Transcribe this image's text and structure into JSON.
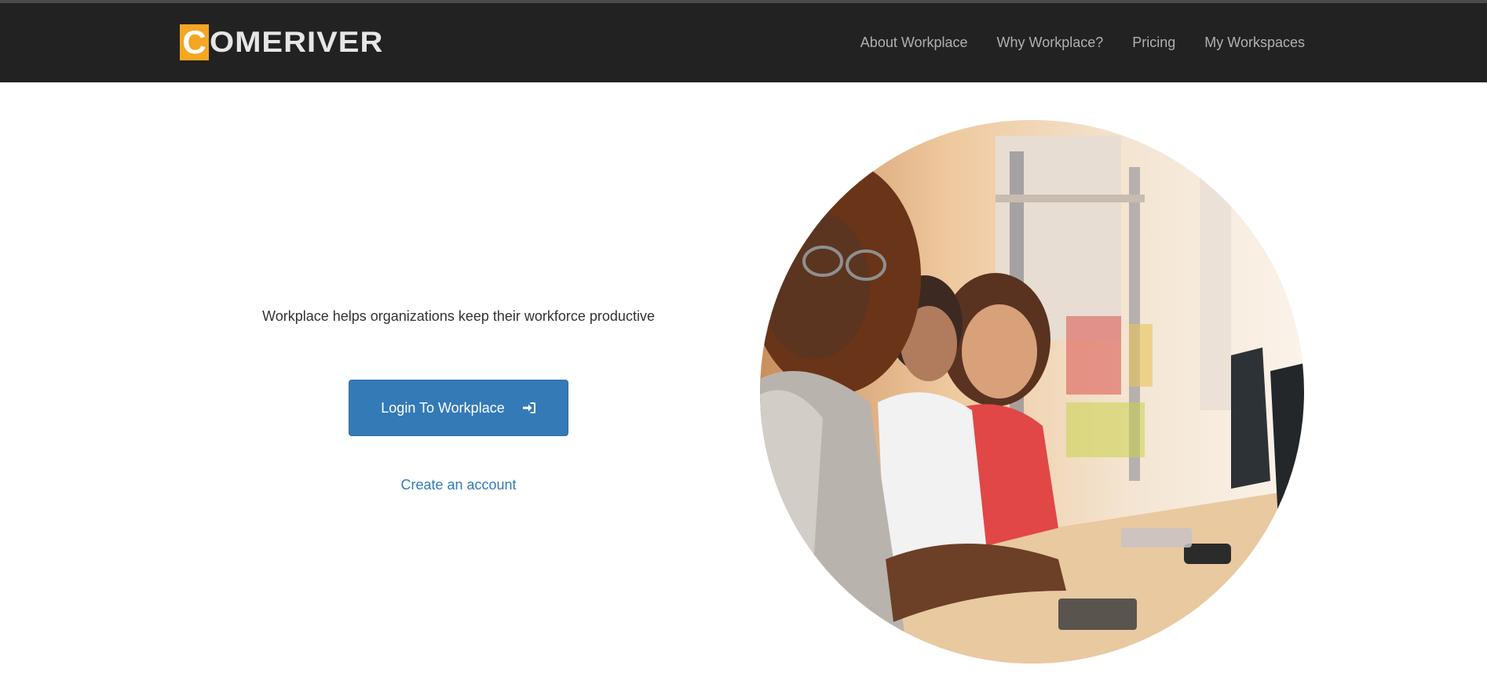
{
  "header": {
    "brand_initial": "C",
    "brand_rest": "OMERIVER",
    "nav": [
      {
        "label": "About Workplace"
      },
      {
        "label": "Why Workplace?"
      },
      {
        "label": "Pricing"
      },
      {
        "label": "My Workspaces"
      }
    ]
  },
  "hero": {
    "tagline": "Workplace helps organizations keep their workforce productive",
    "login_label": "Login To Workplace",
    "login_icon": "sign-in-icon",
    "create_account_label": "Create an account"
  },
  "colors": {
    "navbar_bg": "#222222",
    "brand_accent": "#f5a623",
    "primary": "#337ab7"
  }
}
